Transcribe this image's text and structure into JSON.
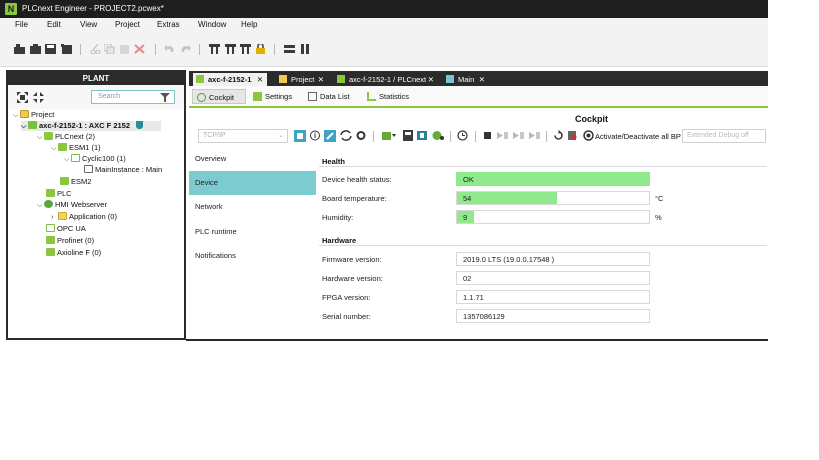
{
  "window": {
    "title": "PLCnext Engineer - PROJECT2.pcwex*",
    "logo": "N"
  },
  "menu": [
    "File",
    "Edit",
    "View",
    "Project",
    "Extras",
    "Window",
    "Help"
  ],
  "toolbar": {
    "icons": [
      "new-project-icon",
      "open-project-icon",
      "save-icon",
      "save-all-icon",
      "cut-icon",
      "copy-icon",
      "paste-icon",
      "delete-icon",
      "undo-icon",
      "redo-icon",
      "network-icon",
      "network-add-icon",
      "network-remove-icon",
      "lock-icon",
      "horizontal-split-icon",
      "vertical-split-icon"
    ]
  },
  "plant": {
    "header": "PLANT",
    "search_placeholder": "Search",
    "tree": [
      {
        "label": "Project",
        "icon": "project-icon",
        "level": 0,
        "expanded": true
      },
      {
        "label": "axc-f-2152-1 : AXC F 2152",
        "icon": "device-icon",
        "level": 1,
        "expanded": true,
        "selected": true
      },
      {
        "label": "PLCnext (2)",
        "icon": "plcnext-icon",
        "level": 2,
        "expanded": true
      },
      {
        "label": "ESM1 (1)",
        "icon": "esm-icon",
        "level": 3,
        "expanded": true
      },
      {
        "label": "Cyclic100 (1)",
        "icon": "task-icon",
        "level": 4,
        "expanded": true
      },
      {
        "label": "MainInstance : Main",
        "icon": "program-instance-icon",
        "level": 5
      },
      {
        "label": "ESM2",
        "icon": "esm-icon",
        "level": 3
      },
      {
        "label": "PLC",
        "icon": "plc-icon",
        "level": 2
      },
      {
        "label": "HMI Webserver",
        "icon": "globe-icon",
        "level": 2,
        "expanded": true
      },
      {
        "label": "Application (0)",
        "icon": "application-icon",
        "level": 3,
        "expanded": false
      },
      {
        "label": "OPC UA",
        "icon": "opcua-icon",
        "level": 2
      },
      {
        "label": "Profinet (0)",
        "icon": "profinet-icon",
        "level": 2
      },
      {
        "label": "Axioline F (0)",
        "icon": "axioline-icon",
        "level": 2
      }
    ]
  },
  "doc_tabs": [
    {
      "label": "axc-f-2152-1",
      "active": true
    },
    {
      "label": "Project",
      "active": false
    },
    {
      "label": "axc-f-2152-1 / PLCnext",
      "active": false
    },
    {
      "label": "Main",
      "active": false
    }
  ],
  "sub_tabs": [
    {
      "label": "Cockpit",
      "active": true
    },
    {
      "label": "Settings",
      "active": false
    },
    {
      "label": "Data List",
      "active": false
    },
    {
      "label": "Statistics",
      "active": false
    }
  ],
  "cockpit": {
    "title": "Cockpit",
    "connection": "TCP/IP",
    "bp_label": "Activate/Deactivate all BP",
    "debug_mode": "Extended Debug off"
  },
  "left_nav": [
    {
      "label": "Overview",
      "active": false
    },
    {
      "label": "Device",
      "active": true
    },
    {
      "label": "Network",
      "active": false
    },
    {
      "label": "PLC runtime",
      "active": false
    },
    {
      "label": "Notifications",
      "active": false
    }
  ],
  "health": {
    "heading": "Health",
    "status_label": "Device health status:",
    "status_value": "OK",
    "temp_label": "Board temperature:",
    "temp_value": "54",
    "temp_fill": 0.52,
    "temp_unit": "°C",
    "humidity_label": "Humidity:",
    "humidity_value": "9",
    "humidity_fill": 0.09,
    "humidity_unit": "%"
  },
  "hardware": {
    "heading": "Hardware",
    "firmware_label": "Firmware version:",
    "firmware_value": "2019.0 LTS (19.0.0.17548 )",
    "hw_label": "Hardware version:",
    "hw_value": "02",
    "fpga_label": "FPGA version:",
    "fpga_value": "1.1.71",
    "serial_label": "Serial number:",
    "serial_value": "1357086129"
  },
  "colors": {
    "accent": "#8cc63f",
    "nav_active": "#7ccbd1",
    "bar_fill": "#90ea8d",
    "dark": "#2b2b2b"
  }
}
